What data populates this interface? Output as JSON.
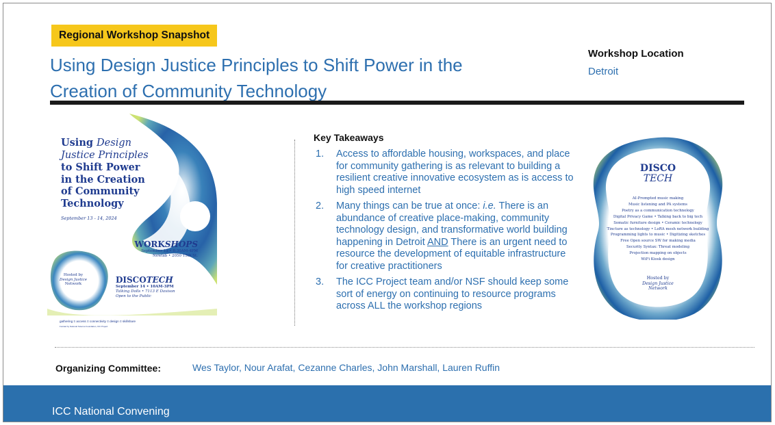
{
  "header": {
    "tag": "Regional Workshop Snapshot",
    "title_line1": "Using Design Justice Principles to Shift Power in the",
    "title_line2": "Creation of Community Technology",
    "location_label": "Workshop Location",
    "location_value": "Detroit"
  },
  "poster": {
    "title_l1a": "Using ",
    "title_l1b": "Design",
    "title_l2": "Justice Principles",
    "title_l3": "to Shift Power",
    "title_l4": "in the Creation",
    "title_l5": "of Community",
    "title_l6": "Technology",
    "date": "September 13 - 14, 2024",
    "workshops_a": "WORK",
    "workshops_b": "SHOPS",
    "workshops_l1": "September 13 • 8:30AM-4PM",
    "workshops_l2": "Newlab • 2050 15th St.",
    "hosted_l1": "Hosted by",
    "hosted_l2": "Design Justice",
    "hosted_l3": "Network",
    "disco_a": "DISCO",
    "disco_b": "TECH",
    "disco_l1": "September 14 • 10AM-3PM",
    "disco_l2": "Talking Dolls • 7113 E Davison",
    "disco_l3": "Open to the Public",
    "footer_line": "gathering  ≡  access  ≡  connectivity  ≡  design  ≡  skillshare",
    "funding_line": "Funded by National Science Foundation, ICC Project"
  },
  "takeaways": {
    "heading": "Key Takeaways",
    "items": [
      {
        "num": "1.",
        "text": "Access to affordable housing, workspaces, and place for community gathering is as relevant to building a resilient creative innovative ecosystem as is access to high speed internet"
      },
      {
        "num": "2.",
        "text_a": "Many things can be true at once: ",
        "text_ie": "i.e.",
        "text_b": " There is an abundance of creative place-making, community technology design, and transformative world building happening in Detroit ",
        "text_and": "AND",
        "text_c": " There is an urgent need to resource the development of equitable infrastructure for creative practitioners"
      },
      {
        "num": "3.",
        "text": "The ICC Project team and/or NSF should keep some sort of energy on continuing to resource programs across ALL the workshop regions"
      }
    ]
  },
  "badge": {
    "title_a": "DISCO",
    "title_b": "TECH",
    "items": [
      "AI-Prompted music making",
      "Music listening and PA systems",
      "Poetry as a communication technology",
      "Digital Privacy Game • Talking back to big tech",
      "Somatic furniture design • Ceramic technology",
      "Tincture as technology • LoRA mesh network building",
      "Programming lights to music • Digitizing sketches",
      "Free Open source SW for making media",
      "Security Syntax: Threat modeling",
      "Projection mapping on objects",
      "WiFi Kiosk design"
    ],
    "hosted_l1": "Hosted by",
    "hosted_l2": "Design Justice",
    "hosted_l3": "Network"
  },
  "committee": {
    "label": "Organizing Committee:",
    "value": "Wes Taylor, Nour Arafat, Cezanne Charles, John Marshall, Lauren Ruffin"
  },
  "footer": {
    "text": "ICC National Convening"
  },
  "colors": {
    "accent_blue": "#2d6faf",
    "tag_yellow": "#f6c71b",
    "footer_blue": "#2b70ad",
    "poster_navy": "#1f3b8f"
  }
}
